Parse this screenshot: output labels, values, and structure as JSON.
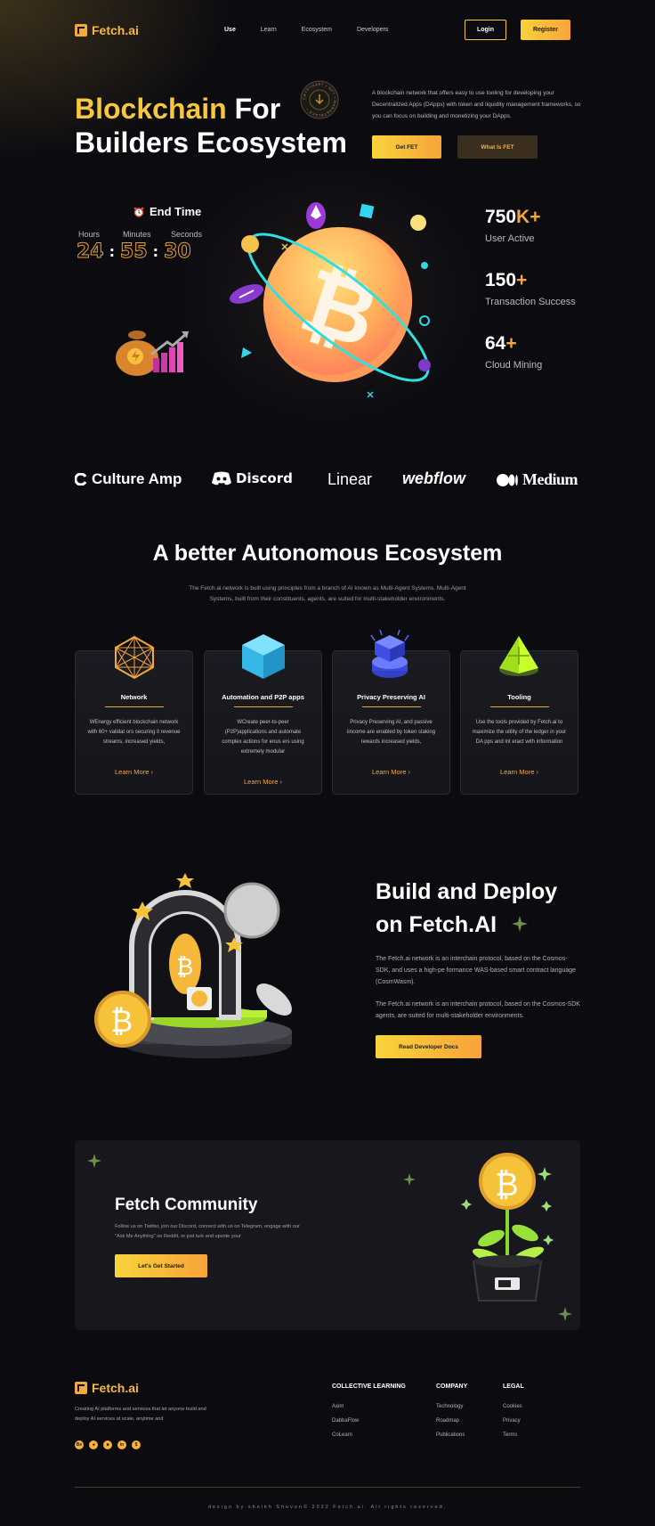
{
  "nav": {
    "logo_text": "Fetch.ai",
    "links": [
      "Use",
      "Learn",
      "Ecosystem",
      "Developers"
    ],
    "login_label": "Login",
    "register_label": "Register"
  },
  "hero": {
    "title_yellow": "Blockchain",
    "title_white_1": "For",
    "title_line2": "Builders Ecosystem",
    "badge_text": "CRYPTOART • NFT • MARKETPLACE •",
    "description": "A blockchain network that offers easy to use tooling for developing your Decentralized Apps (DApps) with token and liquidity management frameworks, so you can focus on building and monetizing your DApps.",
    "primary_btn": "Get FET",
    "secondary_btn": "What Is FET"
  },
  "timer": {
    "title": "End Time",
    "labels": [
      "Hours",
      "Minutes",
      "Seconds"
    ],
    "values": [
      "24",
      "55",
      "30"
    ]
  },
  "stats": [
    {
      "number": "750",
      "suffix": "K+",
      "label": "User Active"
    },
    {
      "number": "150",
      "suffix": "+",
      "label": "Transaction Success"
    },
    {
      "number": "64",
      "suffix": "+",
      "label": "Cloud Mining"
    }
  ],
  "brands": [
    "Culture Amp",
    "Discord",
    "Linear",
    "webflow",
    "Medium"
  ],
  "ecosystem": {
    "title": "A better Autonomous Ecosystem",
    "description_1": "The Fetch.ai network is built using principles from a branch of AI known as Multi-Agent Systems. Multi-Agent",
    "description_2": "Systems, built from their constituents, agents, are suited for multi-stakeholder environments.",
    "cards": [
      {
        "title": "Network",
        "desc": "WEnergy efficient blockchain network with 60+ validat ors securing it revenue streams, increased yields,",
        "link": "Learn More"
      },
      {
        "title": "Automation and P2P apps",
        "desc": "WCreate peer-to-peer (P2P)applications and automate complex actions for enus ers using extremely modular",
        "link": "Learn More"
      },
      {
        "title": "Privacy Preserving AI",
        "desc": "Privacy Preserving AI, and passive iincome are enabled by  token staking rewards increased yields,",
        "link": "Learn More"
      },
      {
        "title": "Tooling",
        "desc": "Use the tools provided by Fetch.ai to maximize the utility of the ledger in your DA pps and int eract with information",
        "link": "Learn More"
      }
    ]
  },
  "build": {
    "title_1": "Build and Deploy",
    "title_2": "on Fetch.AI",
    "desc_1": "The Fetch.ai network is an interchain protocol, based on the Cosmos-SDK, and uses a high-pe formance WAS-based smart contract language (CosmWasm).",
    "desc_2": "The Fetch.ai network is an interchain protocol, based on the Cosmos-SDK agents, are suited for multi-stakeholder environments.",
    "button": "Read Developer Docs"
  },
  "community": {
    "title": "Fetch Community",
    "desc": "Follow us on Twitter, join our Discord, connect with us on Telegram, engage with our \"Ask Me Anything\" on Reddit, or just lurk and upvote your",
    "button": "Let's Get Started"
  },
  "footer": {
    "logo_text": "Fetch.ai",
    "desc": "Creating AI platforms and services that let anyone build and deploy AI services at scale, anytime and",
    "socials": [
      "Be",
      "◂",
      "■",
      "in",
      "$"
    ],
    "columns": [
      {
        "heading": "COLLECTIVE LEARNING",
        "links": [
          "Axim",
          "DabbaFlow",
          "CoLearn"
        ]
      },
      {
        "heading": "COMPANY",
        "links": [
          "Technology",
          "Roadmap",
          "Publications"
        ]
      },
      {
        "heading": "LEGAL",
        "links": [
          "Cookies",
          "Privacy",
          "Terms"
        ]
      }
    ],
    "copyright": "design by sheikh Shovon© 2022 Fetch.ai. All rights reserved."
  },
  "colors": {
    "accent": "#f8c73a",
    "accent_orange": "#f6a63a",
    "background": "#0b0b10",
    "card": "#1b1b22"
  }
}
